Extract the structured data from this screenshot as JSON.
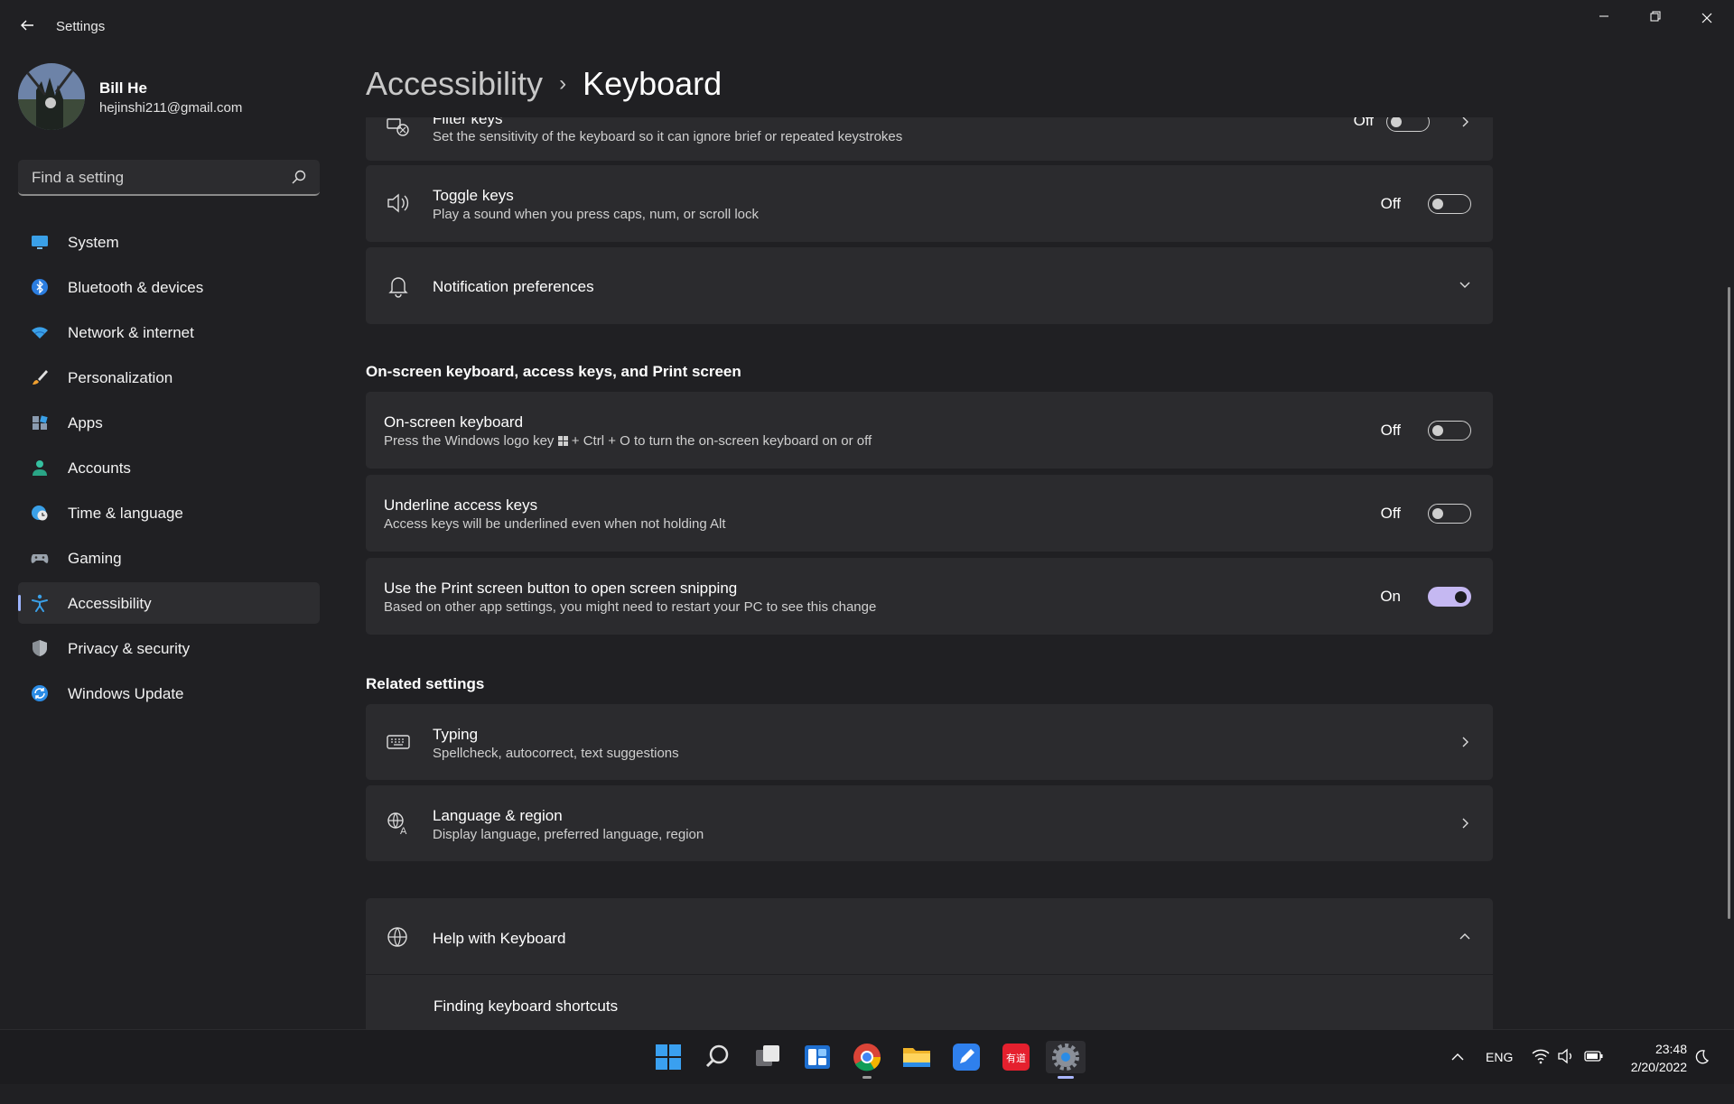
{
  "window": {
    "title": "Settings"
  },
  "profile": {
    "name": "Bill He",
    "email": "hejinshi211@gmail.com"
  },
  "search": {
    "placeholder": "Find a setting"
  },
  "nav": {
    "items": [
      {
        "label": "System",
        "icon": "monitor-icon"
      },
      {
        "label": "Bluetooth & devices",
        "icon": "bluetooth-icon"
      },
      {
        "label": "Network & internet",
        "icon": "wifi-icon"
      },
      {
        "label": "Personalization",
        "icon": "brush-icon"
      },
      {
        "label": "Apps",
        "icon": "apps-icon"
      },
      {
        "label": "Accounts",
        "icon": "person-icon"
      },
      {
        "label": "Time & language",
        "icon": "clock-globe-icon"
      },
      {
        "label": "Gaming",
        "icon": "gamepad-icon"
      },
      {
        "label": "Accessibility",
        "icon": "accessibility-icon",
        "active": true
      },
      {
        "label": "Privacy & security",
        "icon": "shield-icon"
      },
      {
        "label": "Windows Update",
        "icon": "update-icon"
      }
    ]
  },
  "breadcrumb": {
    "parent": "Accessibility",
    "separator": "›",
    "current": "Keyboard"
  },
  "settings": {
    "filter_keys": {
      "title": "Filter keys",
      "desc": "Set the sensitivity of the keyboard so it can ignore brief or repeated keystrokes",
      "state": "Off"
    },
    "toggle_keys": {
      "title": "Toggle keys",
      "desc": "Play a sound when you press caps, num, or scroll lock",
      "state": "Off"
    },
    "notification": {
      "title": "Notification preferences"
    }
  },
  "onscreen_section": {
    "title": "On-screen keyboard, access keys, and Print screen",
    "onscreen_keyboard": {
      "title": "On-screen keyboard",
      "desc_before": "Press the Windows logo key",
      "desc_after": "+ Ctrl + O to turn the on-screen keyboard on or off",
      "state": "Off"
    },
    "underline": {
      "title": "Underline access keys",
      "desc": "Access keys will be underlined even when not holding Alt",
      "state": "Off"
    },
    "print_screen": {
      "title": "Use the Print screen button to open screen snipping",
      "desc": "Based on other app settings, you might need to restart your PC to see this change",
      "state": "On"
    }
  },
  "related": {
    "title": "Related settings",
    "typing": {
      "title": "Typing",
      "desc": "Spellcheck, autocorrect, text suggestions"
    },
    "language": {
      "title": "Language & region",
      "desc": "Display language, preferred language, region"
    }
  },
  "help": {
    "title": "Help with Keyboard",
    "link": "Finding keyboard shortcuts"
  },
  "taskbar": {
    "apps": [
      "start-icon",
      "search-icon",
      "task-view-icon",
      "widgets-icon",
      "chrome-icon",
      "file-explorer-icon",
      "notes-icon",
      "youdao-icon",
      "settings-icon"
    ],
    "youdao_label": "有道",
    "language": "ENG",
    "time": "23:48",
    "date": "2/20/2022"
  },
  "colors": {
    "accent": "#c5b8f2",
    "background": "#202023",
    "card": "#2b2b2e"
  }
}
